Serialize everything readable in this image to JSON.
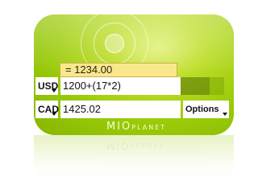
{
  "converter": {
    "result": "= 1234.00",
    "from_currency": "USD",
    "from_value": "1200+(17*2)",
    "to_currency": "CAD",
    "to_value": "1425.02",
    "options_label": "Options"
  },
  "brand": {
    "prefix": "MIO",
    "suffix": "PLANET"
  },
  "colors": {
    "accent_green": "#9ccc0a",
    "result_bg": "#fbe78b"
  }
}
